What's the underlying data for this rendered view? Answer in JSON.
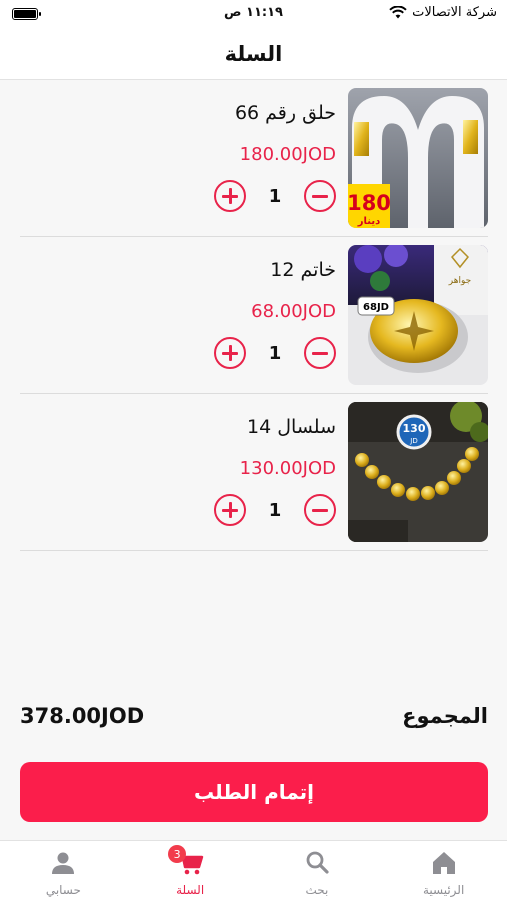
{
  "status_bar": {
    "carrier": "شركة الاتصالات",
    "time": "١١:١٩ ص"
  },
  "header": {
    "title": "السلة"
  },
  "cart": {
    "items": [
      {
        "name": "حلق رقم 66",
        "price": "180.00JOD",
        "quantity": "1",
        "image_caption": "180 دينار"
      },
      {
        "name": "خاتم 12",
        "price": "68.00JOD",
        "quantity": "1",
        "image_caption": "68JD"
      },
      {
        "name": "سلسال 14",
        "price": "130.00JOD",
        "quantity": "1",
        "image_caption": "130 JD"
      }
    ]
  },
  "summary": {
    "total_label": "المجموع",
    "total_value": "378.00JOD"
  },
  "checkout": {
    "label": "إتمام الطلب"
  },
  "tab_bar": {
    "tabs": [
      {
        "label": "الرئيسية",
        "icon": "home-icon"
      },
      {
        "label": "بحث",
        "icon": "search-icon"
      },
      {
        "label": "السلة",
        "icon": "cart-icon",
        "badge": "3",
        "active": true
      },
      {
        "label": "حسابي",
        "icon": "person-icon"
      }
    ]
  },
  "colors": {
    "accent": "#e8234a",
    "checkout_button": "#fb1e4b",
    "badge": "#f23c4c",
    "inactive_tab": "#8e8e93"
  }
}
